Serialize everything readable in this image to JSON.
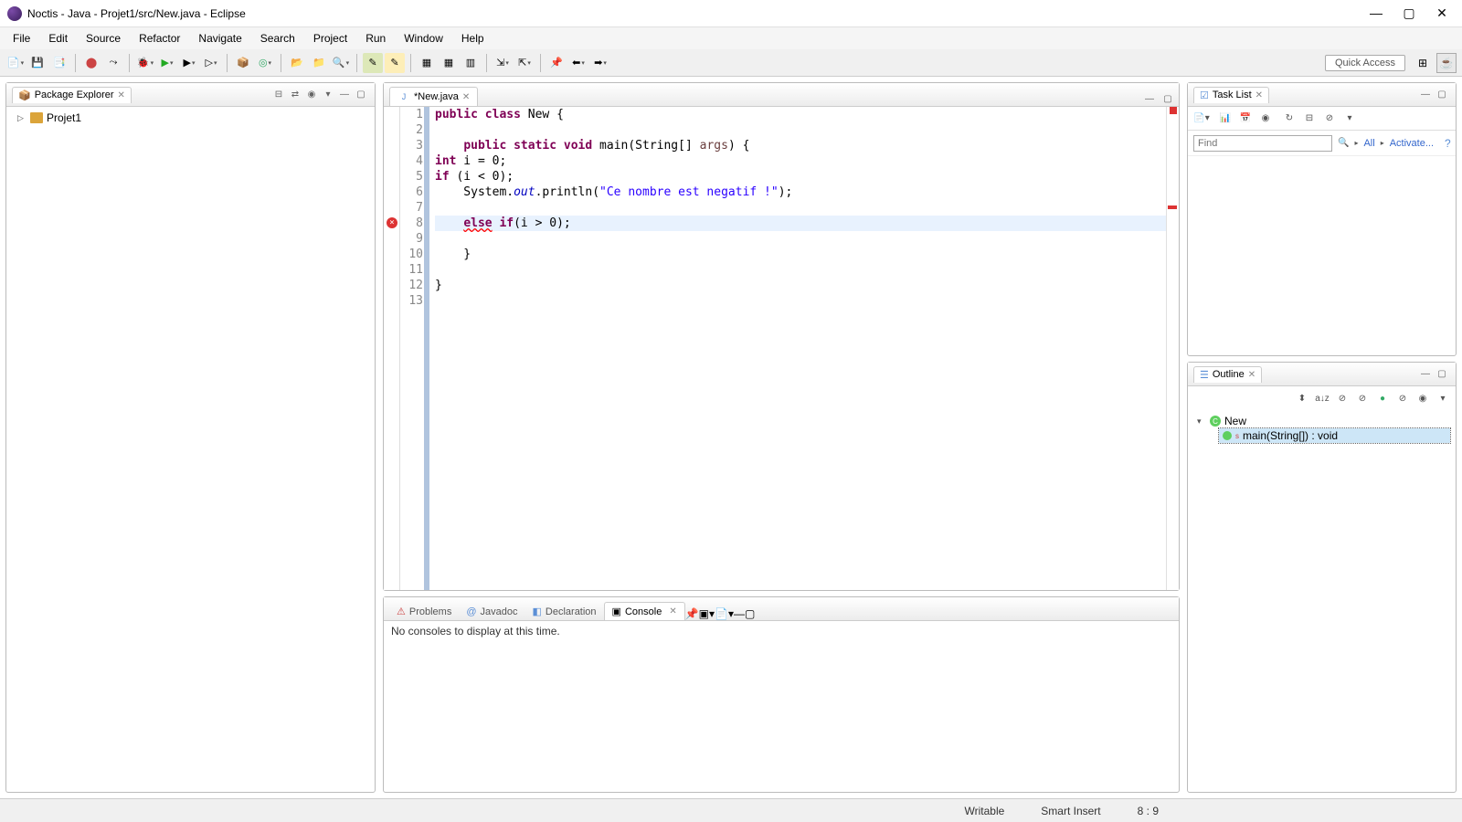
{
  "window": {
    "title": "Noctis - Java - Projet1/src/New.java - Eclipse"
  },
  "menu": [
    "File",
    "Edit",
    "Source",
    "Refactor",
    "Navigate",
    "Search",
    "Project",
    "Run",
    "Window",
    "Help"
  ],
  "quick_access": "Quick Access",
  "package_explorer": {
    "title": "Package Explorer",
    "items": [
      {
        "name": "Projet1"
      }
    ]
  },
  "editor": {
    "tab_title": "*New.java",
    "lines": [
      {
        "n": 1,
        "pre": "",
        "html": "<span class='kw'>public</span> <span class='kw'>class</span> New {"
      },
      {
        "n": 2,
        "pre": "",
        "html": ""
      },
      {
        "n": 3,
        "pre": "    ",
        "html": "<span class='kw'>public</span> <span class='kw'>static</span> <span class='kw'>void</span> main(String[] <span class='param'>args</span>) {"
      },
      {
        "n": 4,
        "pre": "",
        "html": "<span class='kw'>int</span> i = 0;"
      },
      {
        "n": 5,
        "pre": "",
        "html": "<span class='kw'>if</span> (i &lt; 0);"
      },
      {
        "n": 6,
        "pre": "    ",
        "html": "System.<span class='fld'>out</span>.println(<span class='str'>\"Ce nombre est negatif !\"</span>);"
      },
      {
        "n": 7,
        "pre": "",
        "html": ""
      },
      {
        "n": 8,
        "pre": "    ",
        "html": "<span class='kw err'>else</span> <span class='kw'>if</span>(i &gt; 0);",
        "highlight": true,
        "error": true
      },
      {
        "n": 9,
        "pre": "",
        "html": ""
      },
      {
        "n": 10,
        "pre": "    ",
        "html": "}"
      },
      {
        "n": 11,
        "pre": "",
        "html": ""
      },
      {
        "n": 12,
        "pre": "",
        "html": "}"
      },
      {
        "n": 13,
        "pre": "",
        "html": ""
      }
    ]
  },
  "console": {
    "tabs": [
      "Problems",
      "Javadoc",
      "Declaration",
      "Console"
    ],
    "active_tab": 3,
    "message": "No consoles to display at this time."
  },
  "task_list": {
    "title": "Task List",
    "find_placeholder": "Find",
    "all_label": "All",
    "activate_label": "Activate..."
  },
  "outline": {
    "title": "Outline",
    "root": "New",
    "method": "main(String[]) : void"
  },
  "status": {
    "writable": "Writable",
    "insert": "Smart Insert",
    "pos": "8 : 9"
  }
}
